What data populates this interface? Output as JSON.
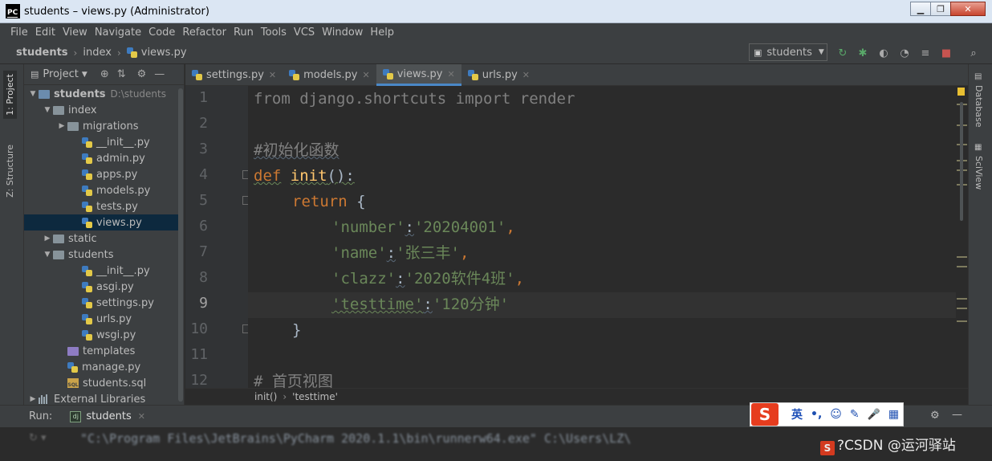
{
  "window": {
    "title": "students – views.py (Administrator)",
    "logo": "PC",
    "buttons": {
      "minimize": "▁",
      "maximize": "❐",
      "close": "✕"
    }
  },
  "menu": {
    "items": [
      "File",
      "Edit",
      "View",
      "Navigate",
      "Code",
      "Refactor",
      "Run",
      "Tools",
      "VCS",
      "Window",
      "Help"
    ]
  },
  "navbar": {
    "crumbs": [
      "students",
      "index",
      "views.py"
    ],
    "run_config": "students"
  },
  "left_strip": {
    "project_tab": "1: Project",
    "structure_tab": "Z: Structure"
  },
  "right_strip": {
    "database_tab": "Database",
    "sciview_tab": "SciView"
  },
  "project": {
    "title": "Project",
    "tree": [
      {
        "label": "students",
        "extra": "D:\\students",
        "kind": "folder-blue",
        "depth": 0,
        "open": true,
        "bold": true
      },
      {
        "label": "index",
        "kind": "folder",
        "depth": 1,
        "open": true
      },
      {
        "label": "migrations",
        "kind": "folder",
        "depth": 2,
        "closed": true
      },
      {
        "label": "__init__.py",
        "kind": "py",
        "depth": 3
      },
      {
        "label": "admin.py",
        "kind": "py",
        "depth": 3
      },
      {
        "label": "apps.py",
        "kind": "py",
        "depth": 3
      },
      {
        "label": "models.py",
        "kind": "py",
        "depth": 3
      },
      {
        "label": "tests.py",
        "kind": "py",
        "depth": 3
      },
      {
        "label": "views.py",
        "kind": "py",
        "depth": 3,
        "selected": true
      },
      {
        "label": "static",
        "kind": "folder",
        "depth": 1,
        "closed": true
      },
      {
        "label": "students",
        "kind": "folder",
        "depth": 1,
        "open": true
      },
      {
        "label": "__init__.py",
        "kind": "py",
        "depth": 3
      },
      {
        "label": "asgi.py",
        "kind": "py",
        "depth": 3
      },
      {
        "label": "settings.py",
        "kind": "py",
        "depth": 3
      },
      {
        "label": "urls.py",
        "kind": "py",
        "depth": 3
      },
      {
        "label": "wsgi.py",
        "kind": "py",
        "depth": 3
      },
      {
        "label": "templates",
        "kind": "folder-purple",
        "depth": 2
      },
      {
        "label": "manage.py",
        "kind": "py",
        "depth": 2
      },
      {
        "label": "students.sql",
        "kind": "sql",
        "depth": 2
      },
      {
        "label": "External Libraries",
        "kind": "lib",
        "depth": 0,
        "closed": true
      }
    ]
  },
  "tabs": [
    {
      "label": "settings.py",
      "active": false
    },
    {
      "label": "models.py",
      "active": false
    },
    {
      "label": "views.py",
      "active": true
    },
    {
      "label": "urls.py",
      "active": false
    }
  ],
  "editor": {
    "line_numbers": [
      "1",
      "2",
      "3",
      "4",
      "5",
      "6",
      "7",
      "8",
      "9",
      "10",
      "11",
      "12"
    ],
    "current_line": "9",
    "code": {
      "l1_from": "from",
      "l1_mod": " django.shortcuts ",
      "l1_import": "import",
      "l1_name": " render",
      "l3_comment": "#初始化函数",
      "l4_def": "def",
      "l4_name": "init",
      "l4_rest": "():",
      "l5_return": "return",
      "l5_brace": " {",
      "l6_key": "'number'",
      "l6_colon": ":",
      "l6_val": "'20204001'",
      "l6_comma": ",",
      "l7_key": "'name'",
      "l7_colon": ":",
      "l7_val": "'张三丰'",
      "l7_comma": ",",
      "l8_key": "'clazz'",
      "l8_colon": ":",
      "l8_val": "'2020软件4班'",
      "l8_comma": ",",
      "l9_key": "'testtime'",
      "l9_colon": ":",
      "l9_val": "'120分钟'",
      "l10_brace": "}",
      "l12_comment": "# 首页视图"
    }
  },
  "code_breadcrumb": [
    "init()",
    "'testtime'"
  ],
  "run": {
    "label": "Run:",
    "tab": "students"
  },
  "ime": {
    "logo": "S",
    "lang": "英",
    "punct": "•,",
    "emoji": "☺",
    "pen": "✎",
    "mic": "🎤",
    "grid": "▦"
  },
  "console": {
    "line": "\"C:\\Program Files\\JetBrains\\PyCharm 2020.1.1\\bin\\runnerw64.exe\" C:\\Users\\LZ\\"
  },
  "watermark": {
    "text": "?CSDN @运河驿站"
  }
}
